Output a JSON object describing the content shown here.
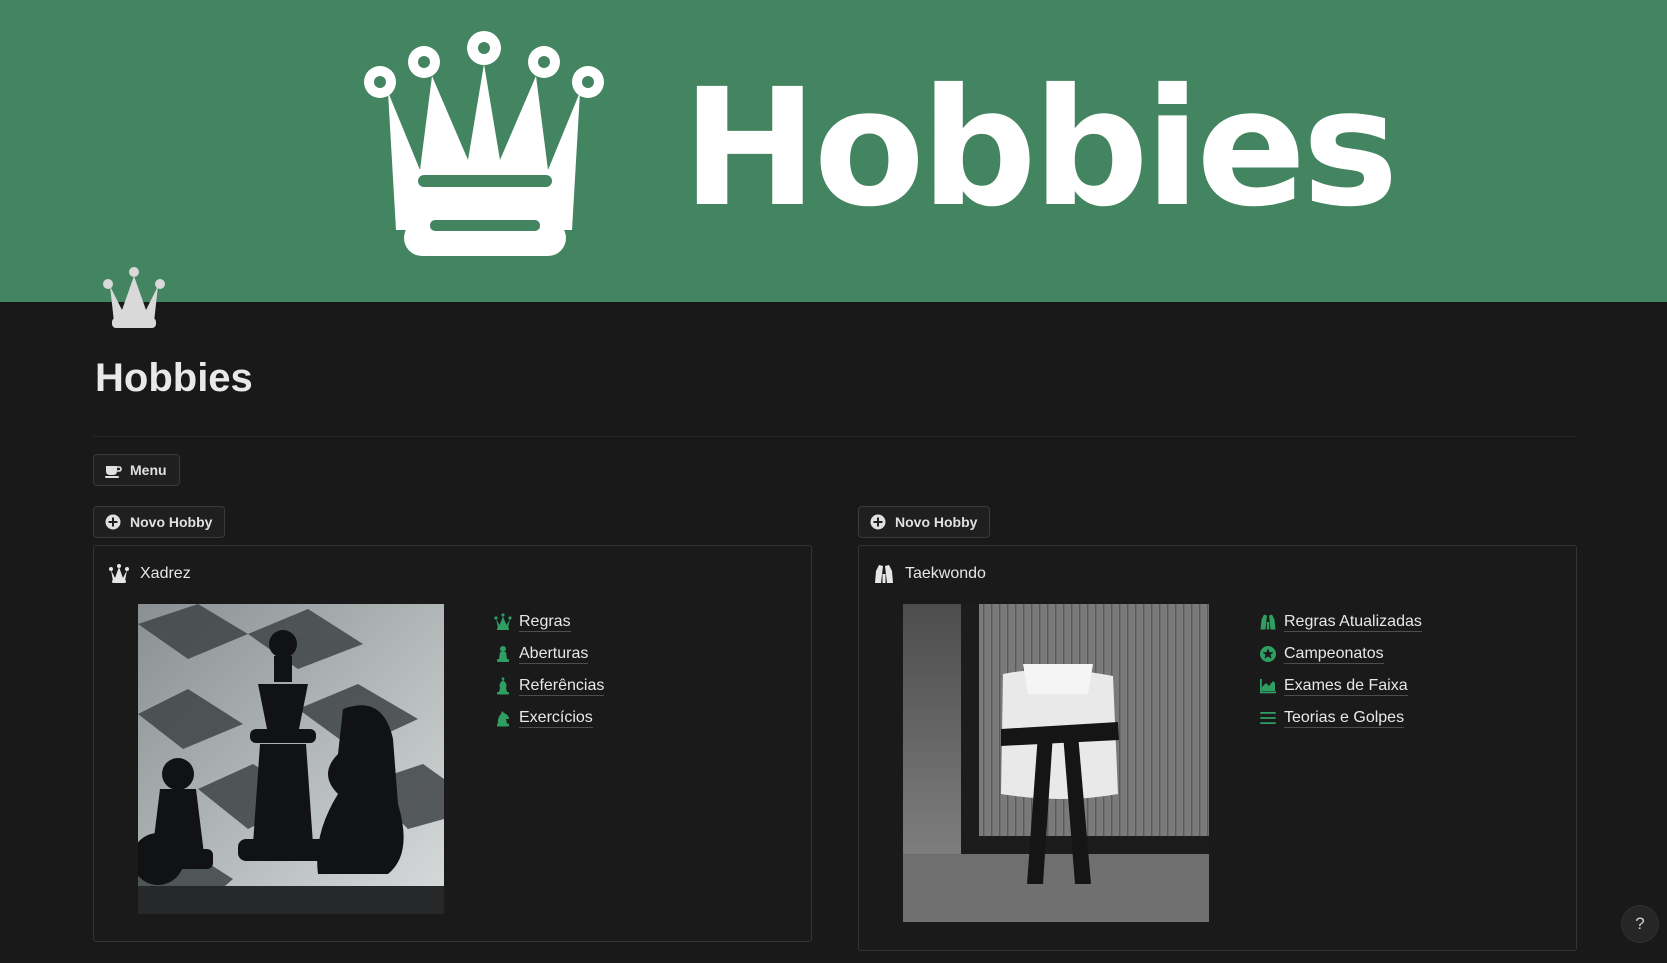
{
  "cover": {
    "text": "Hobbies",
    "color": "#448561"
  },
  "page": {
    "title": "Hobbies",
    "icon": "crown-icon"
  },
  "menu": {
    "label": "Menu",
    "icon": "coffee-cup-icon"
  },
  "columns": [
    {
      "new_button": "Novo Hobby",
      "card": {
        "icon": "chess-queen-icon",
        "title": "Xadrez",
        "image": "chess-pieces-photo",
        "links": [
          {
            "label": "Regras",
            "icon": "chess-queen-icon"
          },
          {
            "label": "Aberturas",
            "icon": "chess-pawn-icon"
          },
          {
            "label": "Referências",
            "icon": "chess-bishop-icon"
          },
          {
            "label": "Exercícios",
            "icon": "chess-knight-icon"
          }
        ]
      }
    },
    {
      "new_button": "Novo Hobby",
      "card": {
        "icon": "uniform-icon",
        "title": "Taekwondo",
        "image": "martial-arts-uniform-photo",
        "links": [
          {
            "label": "Regras Atualizadas",
            "icon": "uniform-icon"
          },
          {
            "label": "Campeonatos",
            "icon": "star-badge-icon"
          },
          {
            "label": "Exames de Faixa",
            "icon": "area-chart-icon"
          },
          {
            "label": "Teorias e Golpes",
            "icon": "list-icon"
          }
        ]
      }
    }
  ],
  "help": {
    "label": "?"
  },
  "accent": "#2e9e63"
}
